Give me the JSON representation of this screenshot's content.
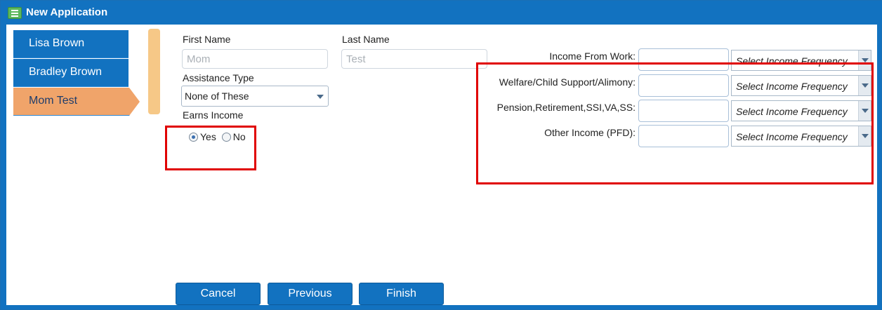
{
  "window": {
    "title": "New Application"
  },
  "people": [
    {
      "name": "Lisa Brown"
    },
    {
      "name": "Bradley Brown"
    },
    {
      "name": "Mom Test"
    }
  ],
  "form": {
    "first_name_label": "First Name",
    "first_name_placeholder": "Mom",
    "last_name_label": "Last Name",
    "last_name_placeholder": "Test",
    "assistance_label": "Assistance Type",
    "assistance_value": "None of These",
    "earns_label": "Earns Income",
    "yes_label": "Yes",
    "no_label": "No",
    "earns_selected": "Yes"
  },
  "income": [
    {
      "label": "Income From Work:",
      "frequency": "Select Income Frequency"
    },
    {
      "label": "Welfare/Child Support/Alimony:",
      "frequency": "Select Income Frequency"
    },
    {
      "label": "Pension,Retirement,SSI,VA,SS:",
      "frequency": "Select Income Frequency"
    },
    {
      "label": "Other Income (PFD):",
      "frequency": "Select Income Frequency"
    }
  ],
  "buttons": {
    "cancel": "Cancel",
    "previous": "Previous",
    "finish": "Finish"
  },
  "colors": {
    "primary": "#1272c0",
    "active_tab": "#f0a46a",
    "highlight": "#e00000"
  },
  "icons": {
    "title": "form-icon"
  }
}
